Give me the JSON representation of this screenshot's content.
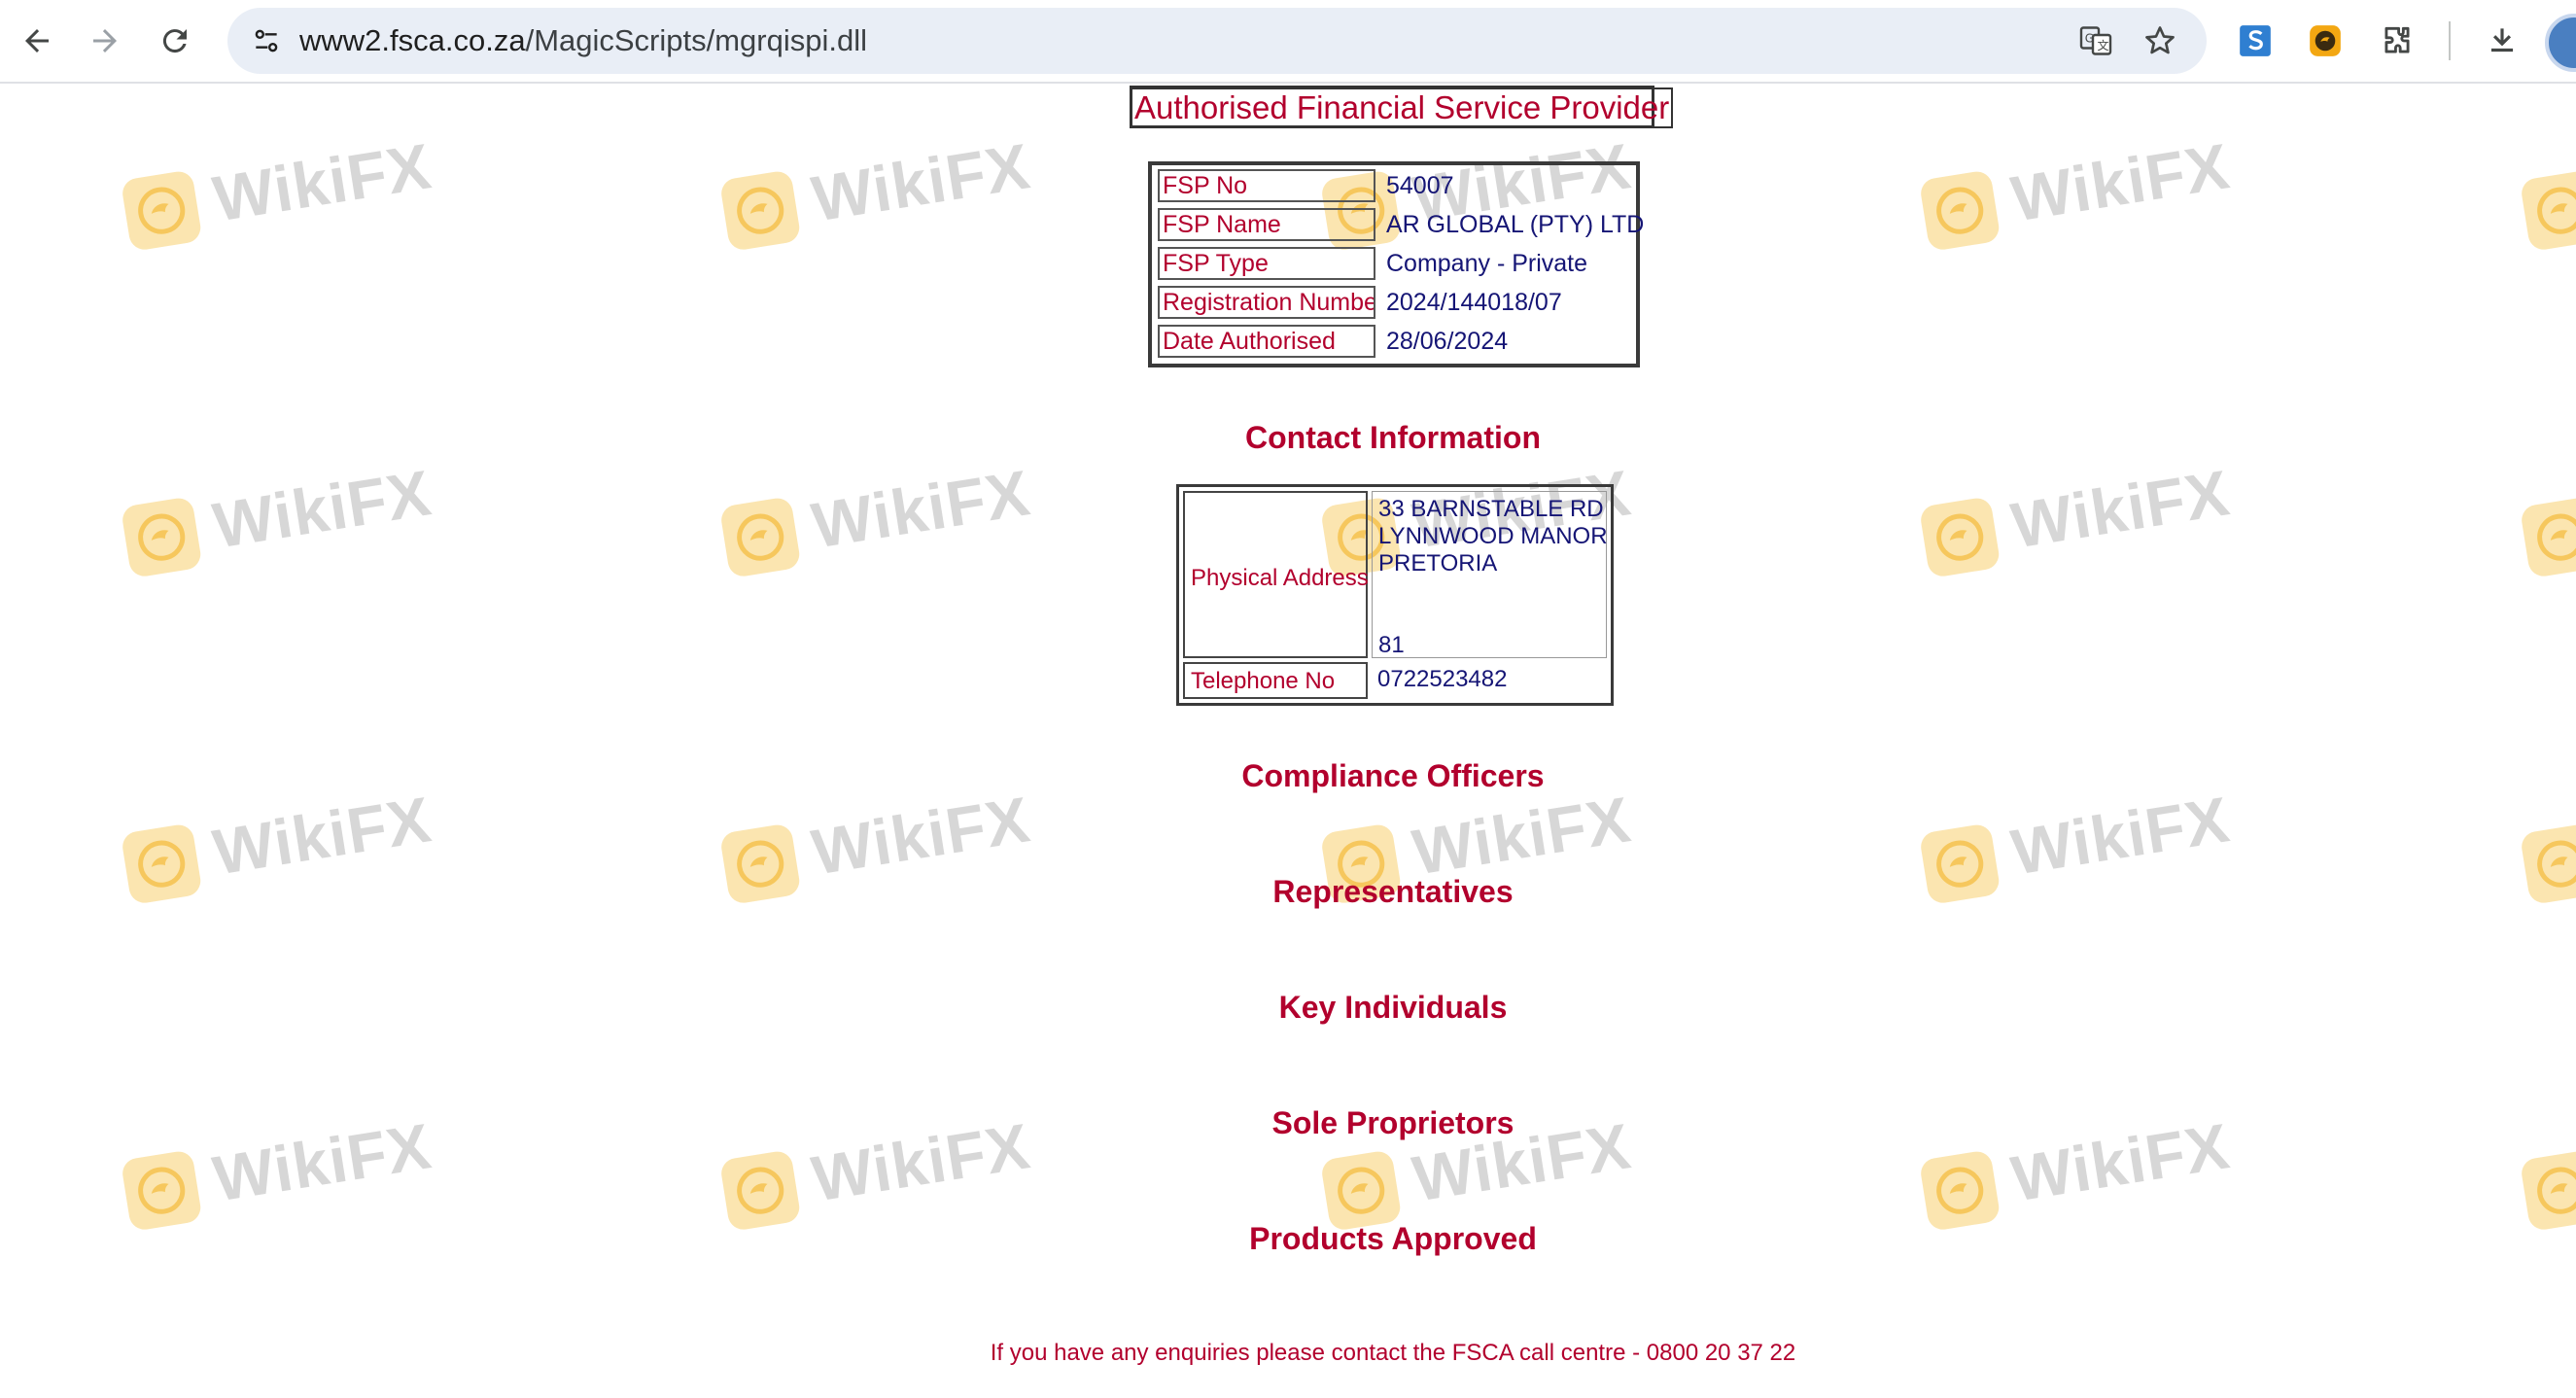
{
  "browser": {
    "url_host": "www2.fsca.co.za",
    "url_path": "/MagicScripts/mgrqispi.dll",
    "icons": {
      "back": "arrow-left-icon",
      "forward": "arrow-right-icon",
      "reload": "reload-icon",
      "site_info": "tune-icon",
      "translate": "translate-icon",
      "bookmark": "star-icon",
      "extension1": "s-extension-icon",
      "extension2": "wikifx-extension-icon",
      "extensions_menu": "puzzle-icon",
      "downloads": "download-icon"
    }
  },
  "page": {
    "title": "Authorised Financial Service Provider",
    "fsp_details": [
      {
        "label": "FSP No",
        "value": "54007"
      },
      {
        "label": "FSP Name",
        "value": "AR GLOBAL (PTY) LTD"
      },
      {
        "label": "FSP Type",
        "value": "Company - Private"
      },
      {
        "label": "Registration Number",
        "value": "2024/144018/07"
      },
      {
        "label": "Date Authorised",
        "value": "28/06/2024"
      }
    ],
    "contact": {
      "heading": "Contact Information",
      "physical_address_label": "Physical Address",
      "address_lines": [
        "33 BARNSTABLE RD",
        "LYNNWOOD MANOR",
        "PRETORIA",
        "81"
      ],
      "telephone_label": "Telephone No",
      "telephone_value": "0722523482"
    },
    "sections": [
      "Compliance Officers",
      "Representatives",
      "Key Individuals",
      "Sole Proprietors",
      "Products Approved"
    ],
    "footer_note": "If you have any enquiries please contact the FSCA call centre - 0800 20 37 22"
  },
  "watermark": {
    "text": "WikiFX",
    "logo_color": "#fbe3a8",
    "text_color": "#d3d3d3"
  },
  "colors": {
    "label_red": "#b2002d",
    "value_navy": "#151575",
    "omnibox_bg": "#e9eef6"
  }
}
